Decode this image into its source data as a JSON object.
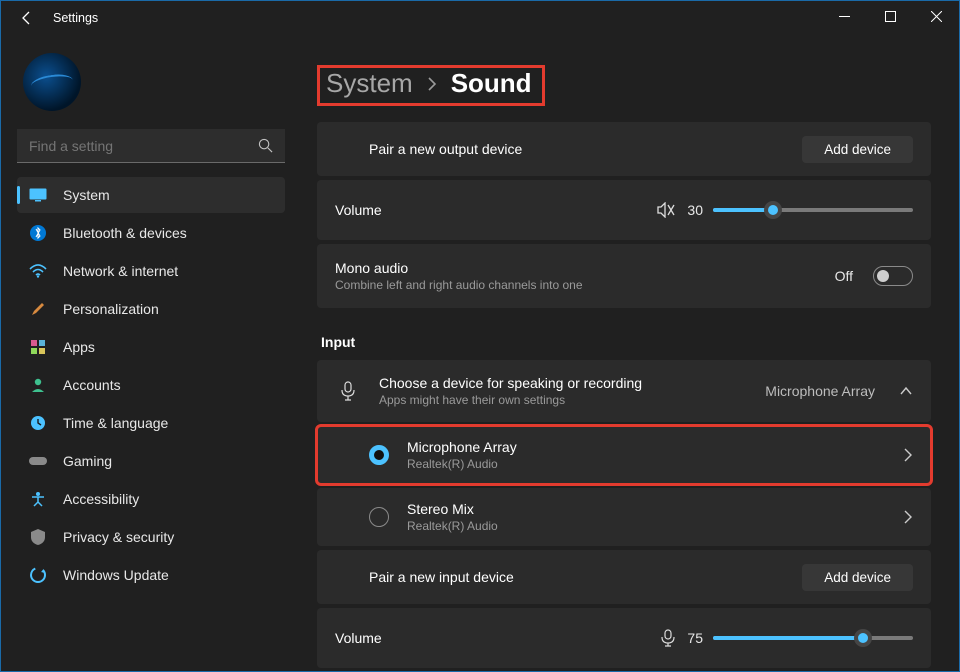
{
  "window": {
    "title": "Settings"
  },
  "search": {
    "placeholder": "Find a setting"
  },
  "nav": [
    {
      "label": "System",
      "active": true
    },
    {
      "label": "Bluetooth & devices"
    },
    {
      "label": "Network & internet"
    },
    {
      "label": "Personalization"
    },
    {
      "label": "Apps"
    },
    {
      "label": "Accounts"
    },
    {
      "label": "Time & language"
    },
    {
      "label": "Gaming"
    },
    {
      "label": "Accessibility"
    },
    {
      "label": "Privacy & security"
    },
    {
      "label": "Windows Update"
    }
  ],
  "breadcrumb": {
    "parent": "System",
    "current": "Sound"
  },
  "output": {
    "pair_label": "Pair a new output device",
    "add_button": "Add device",
    "volume_label": "Volume",
    "volume_value": 30,
    "mono_title": "Mono audio",
    "mono_subtitle": "Combine left and right audio channels into one",
    "mono_state_label": "Off",
    "mono_state": false
  },
  "input": {
    "section_title": "Input",
    "choose_title": "Choose a device for speaking or recording",
    "choose_subtitle": "Apps might have their own settings",
    "selected_device": "Microphone Array",
    "devices": [
      {
        "name": "Microphone Array",
        "driver": "Realtek(R) Audio",
        "selected": true
      },
      {
        "name": "Stereo Mix",
        "driver": "Realtek(R) Audio",
        "selected": false
      }
    ],
    "pair_label": "Pair a new input device",
    "add_button": "Add device",
    "volume_label": "Volume",
    "volume_value": 75
  }
}
